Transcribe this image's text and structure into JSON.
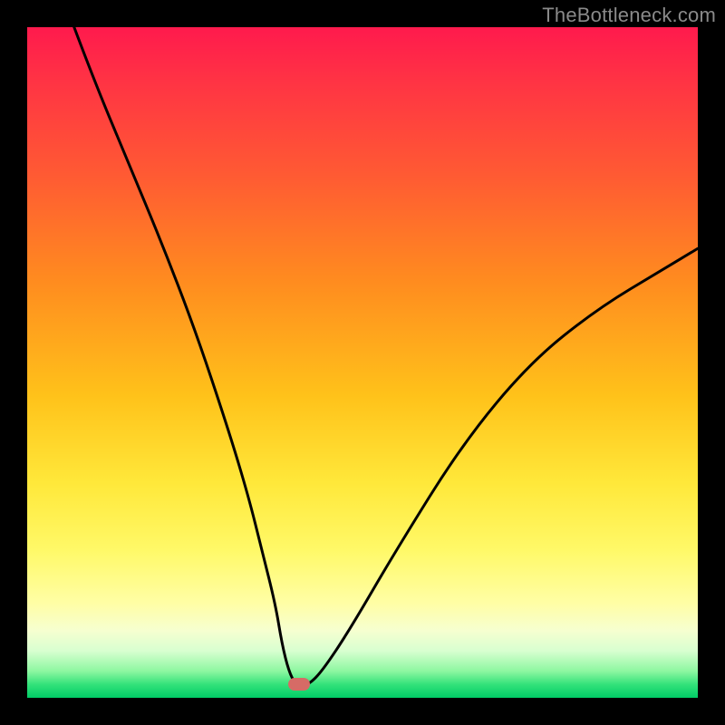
{
  "watermark": "TheBottleneck.com",
  "chart_data": {
    "type": "line",
    "title": "",
    "xlabel": "",
    "ylabel": "",
    "xlim": [
      0,
      100
    ],
    "ylim": [
      0,
      100
    ],
    "series": [
      {
        "name": "bottleneck-curve",
        "x": [
          7,
          10,
          15,
          20,
          25,
          30,
          33,
          35,
          37,
          38,
          39,
          40,
          41,
          42,
          44,
          48,
          55,
          65,
          75,
          85,
          95,
          100
        ],
        "values": [
          100,
          92,
          80,
          68,
          55,
          40,
          30,
          22,
          14,
          8,
          4,
          2,
          2,
          2,
          4,
          10,
          22,
          38,
          50,
          58,
          64,
          67
        ]
      }
    ],
    "marker": {
      "x": 40.5,
      "y": 2,
      "label": "optimal-point"
    },
    "grid": false,
    "legend": false
  },
  "colors": {
    "curve": "#000000",
    "marker": "#d66b66",
    "background_top": "#ff1a4d",
    "background_bottom": "#00cc66"
  }
}
